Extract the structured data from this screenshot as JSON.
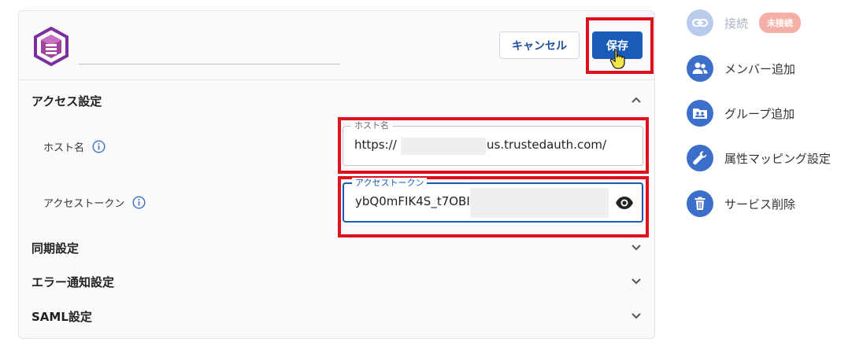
{
  "header": {
    "cancel_label": "キャンセル",
    "save_label": "保存"
  },
  "access": {
    "title": "アクセス設定",
    "host": {
      "label": "ホスト名",
      "legend": "ホスト名",
      "value_prefix": "https://",
      "value_suffix": "us.trustedauth.com/"
    },
    "token": {
      "label": "アクセストークン",
      "legend": "アクセストークン",
      "value_prefix": "ybQ0mFIK4S_t7OBI"
    }
  },
  "sections": {
    "sync": "同期設定",
    "error": "エラー通知設定",
    "saml": "SAML設定"
  },
  "sidebar": {
    "connect": {
      "label": "接続",
      "badge": "未接続"
    },
    "add_member": "メンバー追加",
    "add_group": "グループ追加",
    "attr_mapping": "属性マッピング設定",
    "delete_service": "サービス削除"
  },
  "colors": {
    "primary": "#1a5bb8",
    "highlight": "#e0101e",
    "side_icon": "#3b6fc9",
    "badge": "#f4b0a6",
    "logo": "#7b2f9e"
  },
  "icons": {
    "logo": "cube-logo",
    "info": "info-icon",
    "eye": "eye-icon",
    "link": "link-icon",
    "people": "people-icon",
    "group": "group-icon",
    "wrench": "wrench-icon",
    "trash": "trash-icon"
  }
}
